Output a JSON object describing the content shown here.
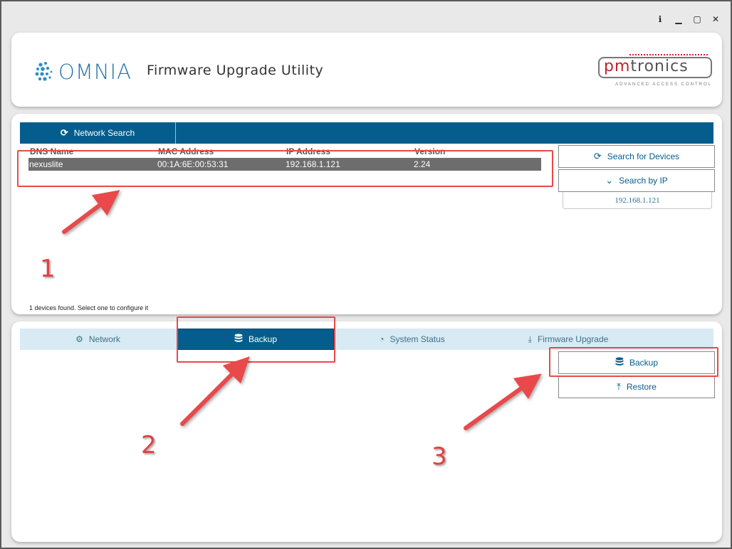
{
  "window": {
    "controls": [
      {
        "name": "info",
        "glyph": "ℹ"
      },
      {
        "name": "minimize",
        "glyph": "▁"
      },
      {
        "name": "maximize",
        "glyph": "▢"
      },
      {
        "name": "close",
        "glyph": "✕"
      }
    ]
  },
  "header": {
    "brand": "OMNIA",
    "title": "Firmware Upgrade Utility",
    "partner_logo_pm": "pm",
    "partner_logo_tronics": "tronics",
    "partner_tagline": "ADVANCED ACCESS CONTROL"
  },
  "network_search": {
    "tab_label": "Network Search",
    "columns": [
      "DNS Name",
      "MAC Address",
      "IP Address",
      "Version"
    ],
    "rows": [
      [
        "nexuslite",
        "00:1A:6E:00:53:31",
        "192.168.1.121",
        "2.24"
      ]
    ],
    "search_devices_label": "Search for Devices",
    "search_ip_label": "Search by IP",
    "ip_value": "192.168.1.121",
    "status": "1 devices found. Select one to configure it"
  },
  "config_tabs": [
    {
      "label": "Network",
      "icon": "gear-icon",
      "active": false
    },
    {
      "label": "Backup",
      "icon": "database-icon",
      "active": true
    },
    {
      "label": "System Status",
      "icon": "dashboard-icon",
      "active": false
    },
    {
      "label": "Firmware Upgrade",
      "icon": "download-icon",
      "active": false
    }
  ],
  "backup_panel": {
    "backup_label": "Backup",
    "restore_label": "Restore"
  },
  "annotations": {
    "step1": "1",
    "step2": "2",
    "step3": "3",
    "color": "#e9494a"
  },
  "colors": {
    "primary": "#045d8c",
    "tab_bg": "#d8eaf3",
    "row_selected": "#6d6d6d",
    "brand_blue": "#2477a9",
    "brand_red": "#c8202a"
  }
}
